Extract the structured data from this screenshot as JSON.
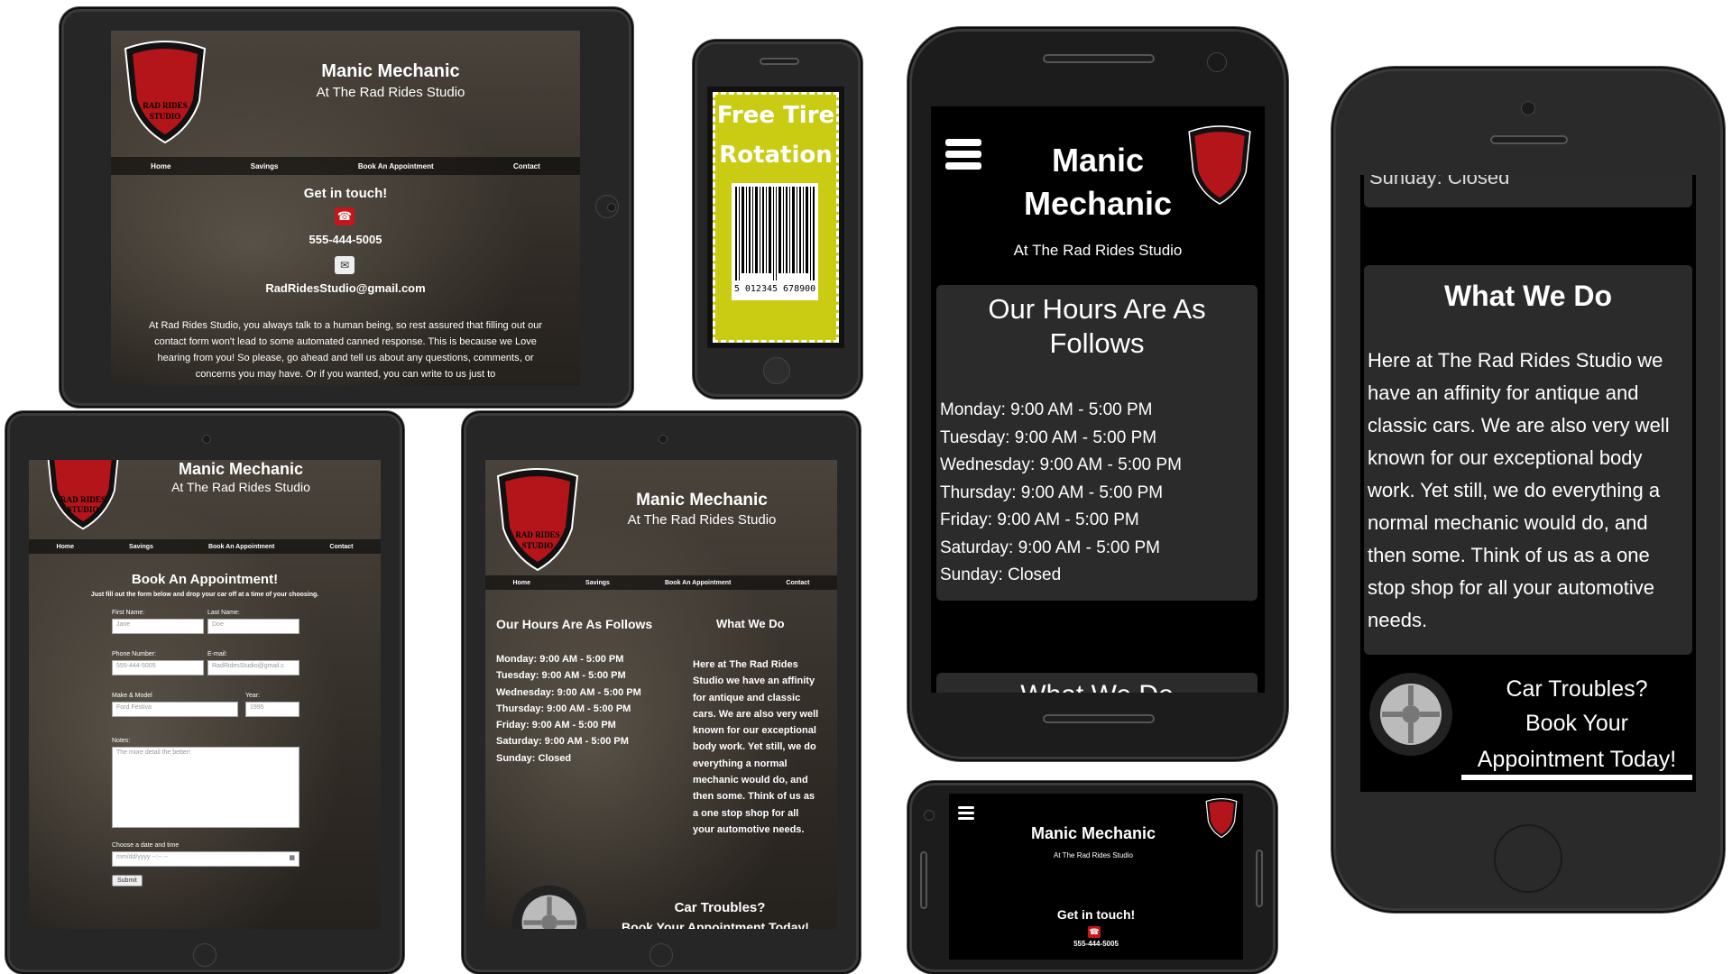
{
  "site": {
    "title": "Manic Mechanic",
    "subtitle": "At The Rad Rides Studio",
    "logo_text": "RAD RIDES STUDIO"
  },
  "nav": {
    "items": [
      "Home",
      "Savings",
      "Book An Appointment",
      "Contact"
    ]
  },
  "contact": {
    "heading": "Get in touch!",
    "phone": "555-444-5005",
    "email": "RadRidesStudio@gmail.com",
    "body": "At Rad Rides Studio, you always talk to a human being, so rest assured that filling out our contact form won't lead to some automated canned response. This is because we Love hearing from you! So please, go ahead and tell us about any questions, comments, or concerns you may have. Or if you wanted, you can write to us just to"
  },
  "coupon": {
    "line1": "Free Tire",
    "line2": "Rotation",
    "barcode_number": "5 012345 678900"
  },
  "hours": {
    "heading": "Our Hours Are As Follows",
    "heading_line1": "Our Hours Are As",
    "heading_line2": "Follows",
    "days": [
      "Monday: 9:00 AM - 5:00 PM",
      "Tuesday: 9:00 AM - 5:00 PM",
      "Wednesday: 9:00 AM - 5:00 PM",
      "Thursday: 9:00 AM - 5:00 PM",
      "Friday: 9:00 AM - 5:00 PM",
      "Saturday: 9:00 AM - 5:00 PM",
      "Sunday: Closed"
    ],
    "sunday_cut": "Sunday: Closed"
  },
  "what_we_do": {
    "heading": "What We Do",
    "body": "Here at The Rad Rides Studio we have an affinity for antique and classic cars. We are also very well known for our exceptional body work. Yet still, we do everything a normal mechanic would do, and then some. Think of us as a one stop shop for all your automotive needs."
  },
  "cta": {
    "line1": "Car Troubles?",
    "line2": "Book Your Appointment Today!",
    "line2a": "Book Your",
    "line2b": "Appointment Today!"
  },
  "booking": {
    "heading": "Book An Appointment!",
    "intro": "Just fill out the form below and drop your car off at a time of your choosing.",
    "first_name_label": "First Name:",
    "first_name_placeholder": "Jane",
    "last_name_label": "Last Name:",
    "last_name_placeholder": "Doe",
    "phone_label": "Phone Number:",
    "phone_placeholder": "555-444-5005",
    "email_label": "E-mail:",
    "email_placeholder": "RadRidesStudio@gmail.c",
    "make_label": "Make & Model",
    "make_placeholder": "Ford Festiva",
    "year_label": "Year:",
    "year_placeholder": "1995",
    "notes_label": "Notes:",
    "notes_placeholder": "The more detail the better!",
    "date_label": "Choose a date and time",
    "date_placeholder": "mm/dd/yyyy --:-- --",
    "submit": "Submit"
  },
  "colors": {
    "accent_red": "#c8151b",
    "coupon_yellow": "#c9cc12",
    "panel": "#2b2b2b"
  },
  "icons": [
    "phone-icon",
    "email-icon",
    "hamburger-menu-icon",
    "tire-icon",
    "shield-logo-icon",
    "calendar-icon"
  ]
}
